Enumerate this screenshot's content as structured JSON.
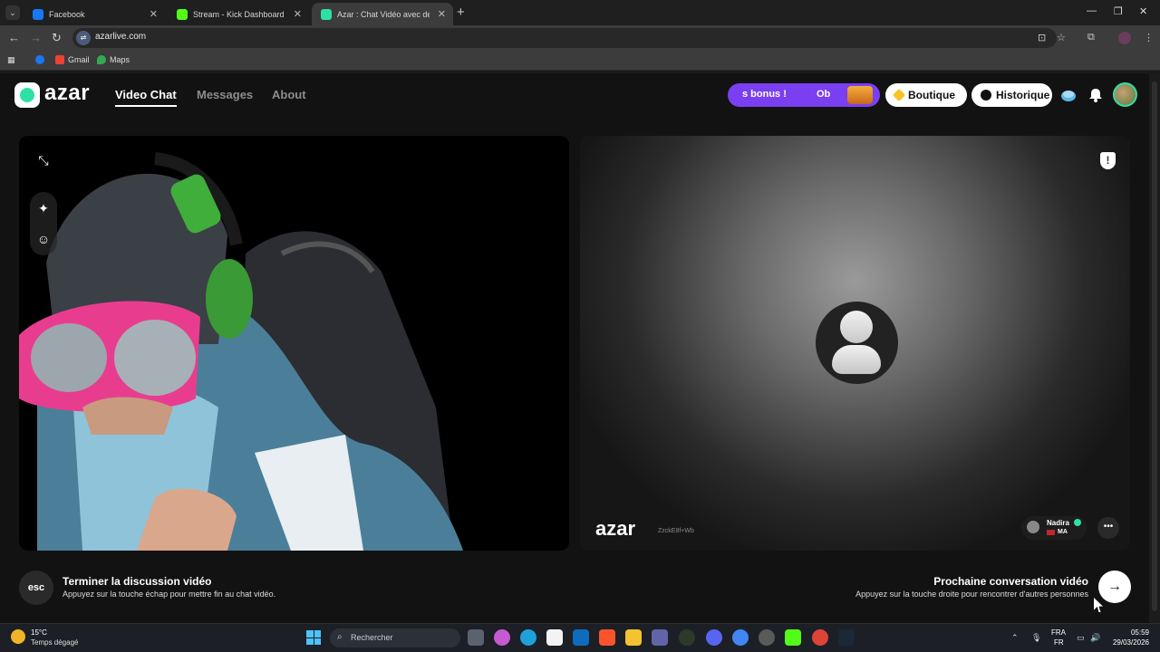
{
  "browser": {
    "tabs": [
      {
        "label": "Facebook",
        "favicon_color": "#1877f2",
        "active": false
      },
      {
        "label": "Stream - Kick Dashboard",
        "favicon_color": "#53fc18",
        "active": false
      },
      {
        "label": "Azar : Chat Vidéo avec de n",
        "favicon_color": "#2fe0a6",
        "active": true
      }
    ],
    "url": "azarlive.com",
    "bookmarks": [
      {
        "label": "",
        "icon": "facebook-icon",
        "color": "#1877f2"
      },
      {
        "label": "Gmail",
        "icon": "gmail-icon",
        "color": "#ea4335"
      },
      {
        "label": "Maps",
        "icon": "maps-icon",
        "color": "#34a853"
      }
    ]
  },
  "header": {
    "logo_text": "azar",
    "nav": [
      {
        "label": "Video Chat",
        "active": true
      },
      {
        "label": "Messages",
        "active": false
      },
      {
        "label": "About",
        "active": false
      }
    ],
    "promo": {
      "text_a": "s bonus !",
      "text_b": "Ob"
    },
    "shop_label": "Boutique",
    "history_label": "Historique",
    "accent_color": "#2fe0a6",
    "promo_color": "#7b3ff2"
  },
  "remote": {
    "watermark": "azar",
    "session_id": "ZzckE8f+Wb",
    "user_name": "Nadira",
    "country": "MA"
  },
  "controls": {
    "esc_label": "esc",
    "end_title": "Terminer la discussion vidéo",
    "end_hint": "Appuyez sur la touche échap pour mettre fin au chat vidéo.",
    "next_title": "Prochaine conversation vidéo",
    "next_hint": "Appuyez sur la touche droite pour rencontrer d'autres personnes"
  },
  "taskbar": {
    "temperature": "15°C",
    "weather": "Temps dégagé",
    "search_placeholder": "Rechercher",
    "lang_top": "FRA",
    "lang_bottom": "FR",
    "time": "05:59",
    "date": "29/03/2026"
  }
}
